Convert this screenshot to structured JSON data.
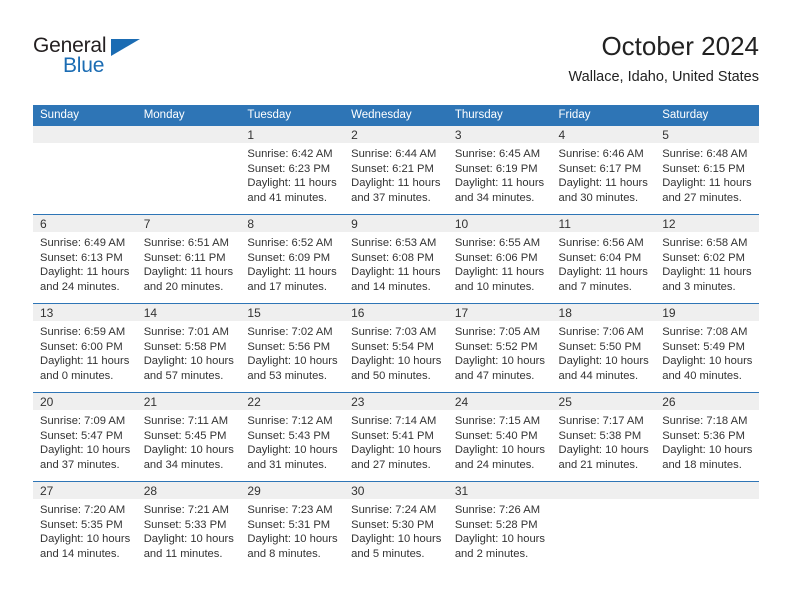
{
  "logo": {
    "word1": "General",
    "word2": "Blue",
    "triangle_color": "#1b6cb3",
    "icon": "triangle-icon"
  },
  "header": {
    "title": "October 2024",
    "subtitle": "Wallace, Idaho, United States"
  },
  "colors": {
    "header_blue": "#2E75B6",
    "daynum_band": "#EFEFEF",
    "text": "#333333"
  },
  "weekday_headers": [
    "Sunday",
    "Monday",
    "Tuesday",
    "Wednesday",
    "Thursday",
    "Friday",
    "Saturday"
  ],
  "labels": {
    "sunrise": "Sunrise:",
    "sunset": "Sunset:",
    "daylight": "Daylight:"
  },
  "weeks": [
    [
      {
        "day": "",
        "sunrise": "",
        "sunset": "",
        "daylight1": "",
        "daylight2": ""
      },
      {
        "day": "",
        "sunrise": "",
        "sunset": "",
        "daylight1": "",
        "daylight2": ""
      },
      {
        "day": "1",
        "sunrise": "Sunrise: 6:42 AM",
        "sunset": "Sunset: 6:23 PM",
        "daylight1": "Daylight: 11 hours",
        "daylight2": "and 41 minutes."
      },
      {
        "day": "2",
        "sunrise": "Sunrise: 6:44 AM",
        "sunset": "Sunset: 6:21 PM",
        "daylight1": "Daylight: 11 hours",
        "daylight2": "and 37 minutes."
      },
      {
        "day": "3",
        "sunrise": "Sunrise: 6:45 AM",
        "sunset": "Sunset: 6:19 PM",
        "daylight1": "Daylight: 11 hours",
        "daylight2": "and 34 minutes."
      },
      {
        "day": "4",
        "sunrise": "Sunrise: 6:46 AM",
        "sunset": "Sunset: 6:17 PM",
        "daylight1": "Daylight: 11 hours",
        "daylight2": "and 30 minutes."
      },
      {
        "day": "5",
        "sunrise": "Sunrise: 6:48 AM",
        "sunset": "Sunset: 6:15 PM",
        "daylight1": "Daylight: 11 hours",
        "daylight2": "and 27 minutes."
      }
    ],
    [
      {
        "day": "6",
        "sunrise": "Sunrise: 6:49 AM",
        "sunset": "Sunset: 6:13 PM",
        "daylight1": "Daylight: 11 hours",
        "daylight2": "and 24 minutes."
      },
      {
        "day": "7",
        "sunrise": "Sunrise: 6:51 AM",
        "sunset": "Sunset: 6:11 PM",
        "daylight1": "Daylight: 11 hours",
        "daylight2": "and 20 minutes."
      },
      {
        "day": "8",
        "sunrise": "Sunrise: 6:52 AM",
        "sunset": "Sunset: 6:09 PM",
        "daylight1": "Daylight: 11 hours",
        "daylight2": "and 17 minutes."
      },
      {
        "day": "9",
        "sunrise": "Sunrise: 6:53 AM",
        "sunset": "Sunset: 6:08 PM",
        "daylight1": "Daylight: 11 hours",
        "daylight2": "and 14 minutes."
      },
      {
        "day": "10",
        "sunrise": "Sunrise: 6:55 AM",
        "sunset": "Sunset: 6:06 PM",
        "daylight1": "Daylight: 11 hours",
        "daylight2": "and 10 minutes."
      },
      {
        "day": "11",
        "sunrise": "Sunrise: 6:56 AM",
        "sunset": "Sunset: 6:04 PM",
        "daylight1": "Daylight: 11 hours",
        "daylight2": "and 7 minutes."
      },
      {
        "day": "12",
        "sunrise": "Sunrise: 6:58 AM",
        "sunset": "Sunset: 6:02 PM",
        "daylight1": "Daylight: 11 hours",
        "daylight2": "and 3 minutes."
      }
    ],
    [
      {
        "day": "13",
        "sunrise": "Sunrise: 6:59 AM",
        "sunset": "Sunset: 6:00 PM",
        "daylight1": "Daylight: 11 hours",
        "daylight2": "and 0 minutes."
      },
      {
        "day": "14",
        "sunrise": "Sunrise: 7:01 AM",
        "sunset": "Sunset: 5:58 PM",
        "daylight1": "Daylight: 10 hours",
        "daylight2": "and 57 minutes."
      },
      {
        "day": "15",
        "sunrise": "Sunrise: 7:02 AM",
        "sunset": "Sunset: 5:56 PM",
        "daylight1": "Daylight: 10 hours",
        "daylight2": "and 53 minutes."
      },
      {
        "day": "16",
        "sunrise": "Sunrise: 7:03 AM",
        "sunset": "Sunset: 5:54 PM",
        "daylight1": "Daylight: 10 hours",
        "daylight2": "and 50 minutes."
      },
      {
        "day": "17",
        "sunrise": "Sunrise: 7:05 AM",
        "sunset": "Sunset: 5:52 PM",
        "daylight1": "Daylight: 10 hours",
        "daylight2": "and 47 minutes."
      },
      {
        "day": "18",
        "sunrise": "Sunrise: 7:06 AM",
        "sunset": "Sunset: 5:50 PM",
        "daylight1": "Daylight: 10 hours",
        "daylight2": "and 44 minutes."
      },
      {
        "day": "19",
        "sunrise": "Sunrise: 7:08 AM",
        "sunset": "Sunset: 5:49 PM",
        "daylight1": "Daylight: 10 hours",
        "daylight2": "and 40 minutes."
      }
    ],
    [
      {
        "day": "20",
        "sunrise": "Sunrise: 7:09 AM",
        "sunset": "Sunset: 5:47 PM",
        "daylight1": "Daylight: 10 hours",
        "daylight2": "and 37 minutes."
      },
      {
        "day": "21",
        "sunrise": "Sunrise: 7:11 AM",
        "sunset": "Sunset: 5:45 PM",
        "daylight1": "Daylight: 10 hours",
        "daylight2": "and 34 minutes."
      },
      {
        "day": "22",
        "sunrise": "Sunrise: 7:12 AM",
        "sunset": "Sunset: 5:43 PM",
        "daylight1": "Daylight: 10 hours",
        "daylight2": "and 31 minutes."
      },
      {
        "day": "23",
        "sunrise": "Sunrise: 7:14 AM",
        "sunset": "Sunset: 5:41 PM",
        "daylight1": "Daylight: 10 hours",
        "daylight2": "and 27 minutes."
      },
      {
        "day": "24",
        "sunrise": "Sunrise: 7:15 AM",
        "sunset": "Sunset: 5:40 PM",
        "daylight1": "Daylight: 10 hours",
        "daylight2": "and 24 minutes."
      },
      {
        "day": "25",
        "sunrise": "Sunrise: 7:17 AM",
        "sunset": "Sunset: 5:38 PM",
        "daylight1": "Daylight: 10 hours",
        "daylight2": "and 21 minutes."
      },
      {
        "day": "26",
        "sunrise": "Sunrise: 7:18 AM",
        "sunset": "Sunset: 5:36 PM",
        "daylight1": "Daylight: 10 hours",
        "daylight2": "and 18 minutes."
      }
    ],
    [
      {
        "day": "27",
        "sunrise": "Sunrise: 7:20 AM",
        "sunset": "Sunset: 5:35 PM",
        "daylight1": "Daylight: 10 hours",
        "daylight2": "and 14 minutes."
      },
      {
        "day": "28",
        "sunrise": "Sunrise: 7:21 AM",
        "sunset": "Sunset: 5:33 PM",
        "daylight1": "Daylight: 10 hours",
        "daylight2": "and 11 minutes."
      },
      {
        "day": "29",
        "sunrise": "Sunrise: 7:23 AM",
        "sunset": "Sunset: 5:31 PM",
        "daylight1": "Daylight: 10 hours",
        "daylight2": "and 8 minutes."
      },
      {
        "day": "30",
        "sunrise": "Sunrise: 7:24 AM",
        "sunset": "Sunset: 5:30 PM",
        "daylight1": "Daylight: 10 hours",
        "daylight2": "and 5 minutes."
      },
      {
        "day": "31",
        "sunrise": "Sunrise: 7:26 AM",
        "sunset": "Sunset: 5:28 PM",
        "daylight1": "Daylight: 10 hours",
        "daylight2": "and 2 minutes."
      },
      {
        "day": "",
        "sunrise": "",
        "sunset": "",
        "daylight1": "",
        "daylight2": ""
      },
      {
        "day": "",
        "sunrise": "",
        "sunset": "",
        "daylight1": "",
        "daylight2": ""
      }
    ]
  ]
}
